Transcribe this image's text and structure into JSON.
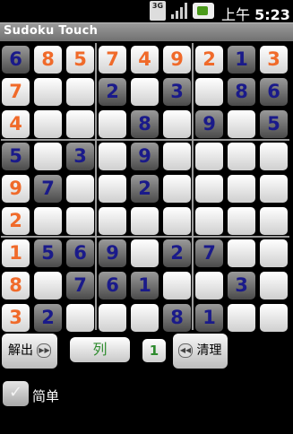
{
  "status_bar": {
    "network": "3G",
    "time_prefix": "上午",
    "time": "5:23"
  },
  "app": {
    "title": "Sudoku Touch"
  },
  "board": {
    "rows": [
      [
        "6",
        "8",
        "5",
        "7",
        "4",
        "9",
        "2",
        "1",
        "3"
      ],
      [
        "7",
        "",
        "",
        "2",
        "",
        "3",
        "",
        "8",
        "6"
      ],
      [
        "4",
        "",
        "",
        "",
        "8",
        "",
        "9",
        "",
        "5"
      ],
      [
        "5",
        "",
        "3",
        "",
        "9",
        "",
        "",
        "",
        ""
      ],
      [
        "9",
        "7",
        "",
        "",
        "2",
        "",
        "",
        "",
        ""
      ],
      [
        "2",
        "",
        "",
        "",
        "",
        "",
        "",
        "",
        ""
      ],
      [
        "1",
        "5",
        "6",
        "9",
        "",
        "2",
        "7",
        "",
        ""
      ],
      [
        "8",
        "",
        "7",
        "6",
        "1",
        "",
        "",
        "3",
        ""
      ],
      [
        "3",
        "2",
        "",
        "",
        "",
        "8",
        "1",
        "",
        ""
      ]
    ],
    "kinds": [
      [
        "b",
        "o",
        "o",
        "o",
        "o",
        "o",
        "o",
        "b",
        "o"
      ],
      [
        "o",
        "e",
        "e",
        "b",
        "e",
        "b",
        "e",
        "b",
        "b"
      ],
      [
        "o",
        "e",
        "e",
        "e",
        "b",
        "e",
        "b",
        "e",
        "b"
      ],
      [
        "b",
        "e",
        "b",
        "e",
        "b",
        "e",
        "e",
        "e",
        "e"
      ],
      [
        "o",
        "b",
        "e",
        "e",
        "b",
        "e",
        "e",
        "e",
        "e"
      ],
      [
        "o",
        "e",
        "e",
        "e",
        "e",
        "e",
        "e",
        "e",
        "e"
      ],
      [
        "o",
        "b",
        "b",
        "b",
        "e",
        "b",
        "b",
        "e",
        "e"
      ],
      [
        "o",
        "e",
        "b",
        "b",
        "b",
        "e",
        "e",
        "b",
        "e"
      ],
      [
        "o",
        "b",
        "e",
        "e",
        "e",
        "b",
        "b",
        "e",
        "e"
      ]
    ],
    "colors": {
      "given": "#f06a2a",
      "entered": "#1a1a8a"
    }
  },
  "controls": {
    "solve_label": "解出",
    "solve_icon": "fast-forward-icon",
    "mode_label": "列",
    "number_value": "1",
    "clear_label": "清理",
    "clear_icon": "rewind-icon",
    "simple_label": "简单",
    "simple_checked": true
  }
}
